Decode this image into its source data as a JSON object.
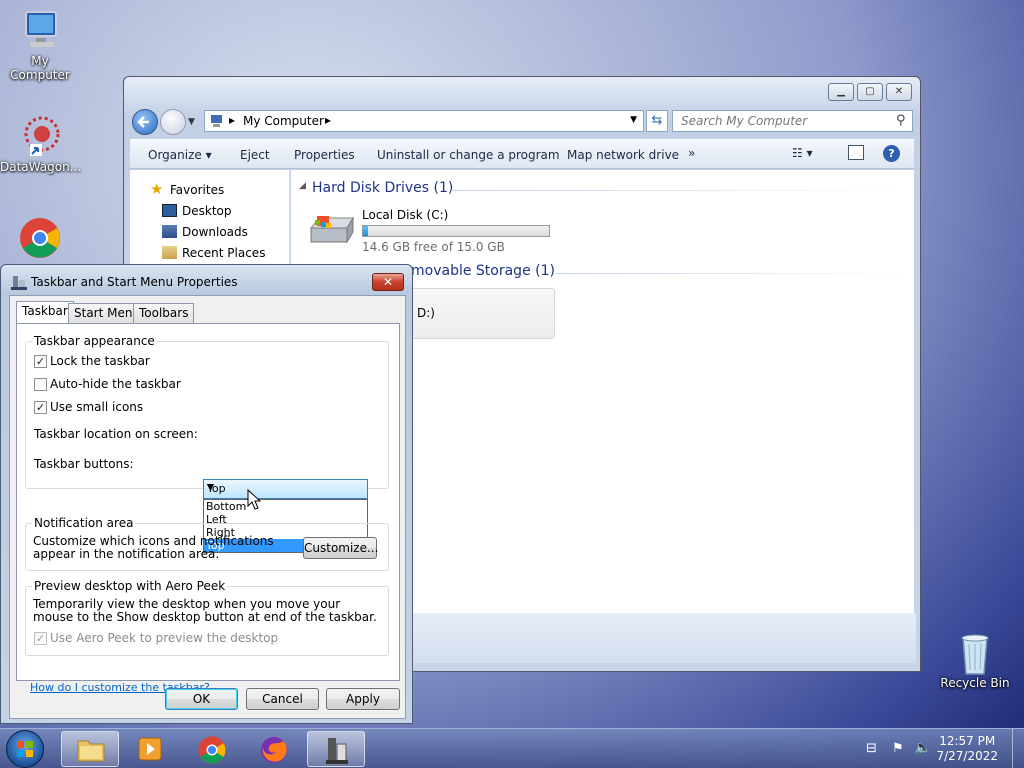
{
  "desktop": {
    "icons": [
      {
        "label": "My Computer"
      },
      {
        "label": "DataWagon..."
      },
      {
        "label": ""
      },
      {
        "label": "Recycle Bin"
      }
    ]
  },
  "explorer": {
    "breadcrumb": "My Computer",
    "search_placeholder": "Search My Computer",
    "toolbar": [
      "Organize",
      "Eject",
      "Properties",
      "Uninstall or change a program",
      "Map network drive",
      "»"
    ],
    "nav": {
      "favorites": "Favorites",
      "items": [
        "Desktop",
        "Downloads",
        "Recent Places"
      ]
    },
    "groups": {
      "hdd": "Hard Disk Drives (1)",
      "removable": "movable Storage (1)"
    },
    "disk": {
      "name": "Local Disk (C:)",
      "free": "14.6 GB free of 15.0 GB",
      "used_fraction": 0.027
    },
    "removable_item": "D:)"
  },
  "dialog": {
    "title": "Taskbar and Start Menu Properties",
    "close": "✕",
    "tabs": [
      "Taskbar",
      "Start Menu",
      "Toolbars"
    ],
    "appearance": {
      "label": "Taskbar appearance",
      "lock": "Lock the taskbar",
      "autohide": "Auto-hide the taskbar",
      "small_icons": "Use small icons",
      "location_label": "Taskbar location on screen:",
      "location_value": "Top",
      "location_options": [
        "Bottom",
        "Left",
        "Right",
        "Top"
      ],
      "buttons_label": "Taskbar buttons:"
    },
    "notification": {
      "label": "Notification area",
      "text": "Customize which icons and notifications appear in the notification area.",
      "button": "Customize..."
    },
    "aero": {
      "label": "Preview desktop with Aero Peek",
      "text": "Temporarily view the desktop when you move your mouse to the Show desktop button at end of the taskbar.",
      "checkbox": "Use Aero Peek to preview the desktop"
    },
    "help_link": "How do I customize the taskbar?",
    "ok": "OK",
    "cancel": "Cancel",
    "apply": "Apply"
  },
  "taskbar": {
    "time": "12:57 PM",
    "date": "7/27/2022"
  }
}
